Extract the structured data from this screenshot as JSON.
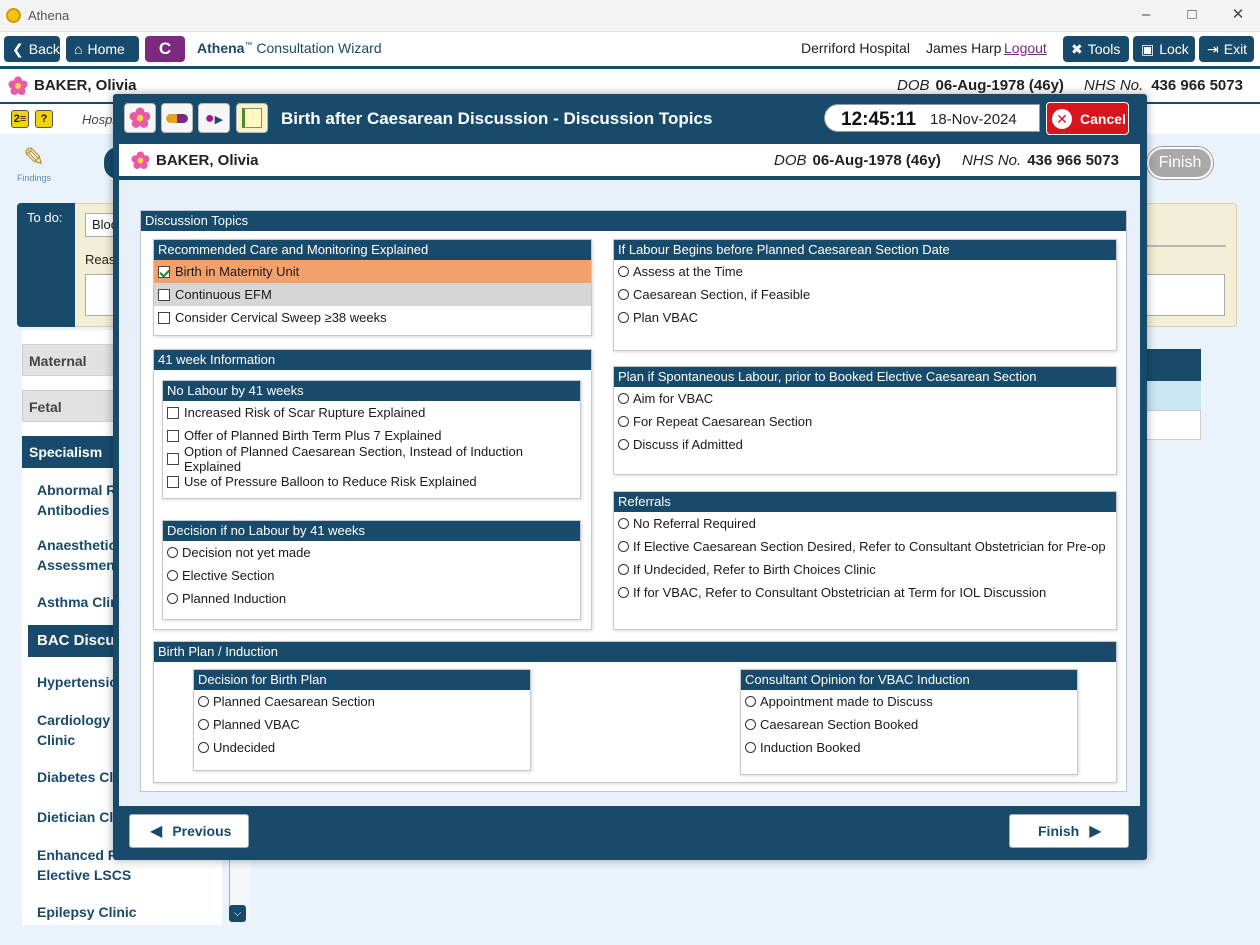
{
  "window": {
    "title": "Athena"
  },
  "toolbar": {
    "back_label": "Back",
    "home_label": "Home",
    "c_label": "C",
    "app_name": "Athena",
    "app_tm": "™",
    "wizard_name": "Consultation Wizard",
    "hospital": "Derriford Hospital",
    "user": "James Harp",
    "logout": "Logout",
    "tools_label": "Tools",
    "lock_label": "Lock",
    "exit_label": "Exit"
  },
  "patient": {
    "name": "BAKER, Olivia",
    "dob_label": "DOB",
    "dob": "06-Aug-1978 (46y)",
    "nhs_label": "NHS No.",
    "nhs": "436 966 5073"
  },
  "background": {
    "hospital_partial": "Hospi",
    "findings_label": "Findings",
    "todo_label": "To do:",
    "todo_value_partial": "Bloo",
    "reason_partial": "Reas",
    "finish_label": "Finish",
    "sidebar": {
      "maternal": "Maternal",
      "fetal": "Fetal",
      "specialism": "Specialism",
      "items": [
        {
          "label": "Abnormal R\nAntibodies"
        },
        {
          "label": "Anaesthetic\nAssessment"
        },
        {
          "label": "Asthma Clir"
        },
        {
          "label": "BAC Discuss"
        },
        {
          "label": "Hypertensio"
        },
        {
          "label": "Cardiology\nClinic"
        },
        {
          "label": "Diabetes Cl"
        },
        {
          "label": "Dietician Cl"
        },
        {
          "label": "Enhanced R\nElective LSCS"
        },
        {
          "label": "Epilepsy Clinic"
        }
      ]
    }
  },
  "modal": {
    "title": "Birth after Caesarean Discussion - Discussion Topics",
    "time": "12:45:11",
    "date": "18-Nov-2024",
    "cancel_label": "Cancel",
    "previous_label": "Previous",
    "finish_label": "Finish",
    "discussion_topics": "Discussion Topics",
    "recommended": {
      "title": "Recommended Care and Monitoring Explained",
      "items": [
        {
          "label": "Birth in Maternity Unit",
          "checked": true
        },
        {
          "label": "Continuous EFM",
          "checked": false
        },
        {
          "label": "Consider Cervical Sweep ≥38 weeks",
          "checked": false
        }
      ]
    },
    "week41": {
      "title": "41 week Information",
      "no_labour": {
        "title": "No Labour by 41 weeks",
        "items": [
          {
            "label": "Increased Risk of Scar Rupture Explained",
            "checked": false
          },
          {
            "label": "Offer of Planned Birth Term Plus 7 Explained",
            "checked": false
          },
          {
            "label": "Option of Planned Caesarean Section, Instead of Induction Explained",
            "checked": false
          },
          {
            "label": "Use of Pressure Balloon to Reduce Risk Explained",
            "checked": false
          }
        ]
      },
      "decision": {
        "title": "Decision if no Labour by 41 weeks",
        "options": [
          "Decision not yet made",
          "Elective Section",
          "Planned Induction"
        ]
      }
    },
    "labour_before": {
      "title": "If Labour Begins before Planned Caesarean Section Date",
      "options": [
        "Assess at the Time",
        "Caesarean Section, if Feasible",
        "Plan VBAC"
      ]
    },
    "spontaneous": {
      "title": "Plan if Spontaneous Labour, prior to Booked Elective Caesarean Section",
      "options": [
        "Aim for VBAC",
        "For Repeat Caesarean Section",
        "Discuss if Admitted"
      ]
    },
    "referrals": {
      "title": "Referrals",
      "options": [
        "No Referral Required",
        "If Elective Caesarean Section Desired, Refer to Consultant Obstetrician for Pre-op",
        "If Undecided, Refer to Birth Choices Clinic",
        "If for VBAC, Refer to Consultant Obstetrician at Term for IOL Discussion"
      ]
    },
    "birth_plan": {
      "title": "Birth Plan / Induction",
      "decision": {
        "title": "Decision for Birth Plan",
        "options": [
          "Planned Caesarean Section",
          "Planned VBAC",
          "Undecided"
        ]
      },
      "consultant": {
        "title": "Consultant Opinion for VBAC Induction",
        "options": [
          "Appointment made to Discuss",
          "Caesarean Section Booked",
          "Induction Booked"
        ]
      }
    }
  },
  "colors": {
    "primary": "#184b6b",
    "purple": "#7b2a80",
    "cancel_red": "#d8141c",
    "highlight_orange": "#f4a06a",
    "background_light": "#e8f1f9"
  }
}
